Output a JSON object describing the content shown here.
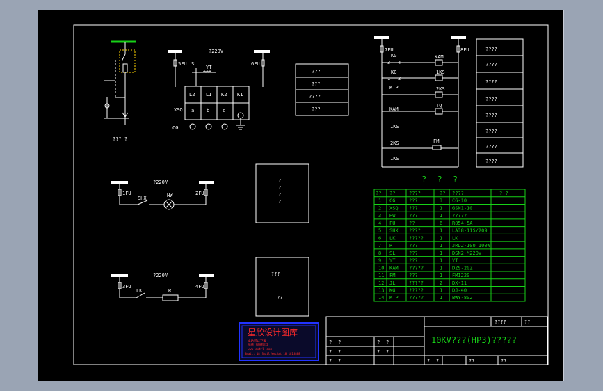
{
  "diagram": {
    "control_circuit": {
      "voltage": "?220V",
      "fuse_left": "5FU",
      "fuse_right": "6FU",
      "sl": "SL",
      "yt": "YT",
      "terminals": [
        "L2",
        "L1",
        "K2",
        "K1"
      ],
      "xsq": "XSQ",
      "contacts": [
        "a",
        "b",
        "c"
      ],
      "cg": "CG"
    },
    "primary_label": "??? ?",
    "legend_small": [
      "???",
      "???",
      "????",
      "???"
    ],
    "right_circuit": {
      "fu_left": "7FU",
      "fu_right": "8FU",
      "row_labels": [
        "KG",
        "3",
        "4",
        "KG",
        "1",
        "2",
        "KTP",
        "KAM",
        "1KS",
        "2KS",
        "1KS"
      ],
      "coil_labels": [
        "KAM",
        "1KS",
        "2KS",
        "TQ",
        "FM"
      ]
    },
    "right_legend": [
      "????",
      "????",
      "????",
      "????",
      "????",
      "????",
      "????",
      "????"
    ],
    "signal_circuit": {
      "voltage": "?220V",
      "fu_left": "1FU",
      "fu_right": "2FU",
      "switch": "SHX",
      "lamp": "HW"
    },
    "heater_circuit": {
      "voltage": "?220V",
      "fu_left": "3FU",
      "fu_right": "4FU",
      "switch": "LK",
      "resistor": "R"
    },
    "box1_lines": [
      "?",
      "?",
      "?",
      "?"
    ],
    "box2_lines": [
      "???",
      "??"
    ],
    "table_title": "? ? ?",
    "table_headers": [
      "??",
      "??",
      "????",
      "??",
      "????",
      "? ?"
    ],
    "table_rows": [
      [
        "1",
        "CG",
        "???",
        "3",
        "CG-10"
      ],
      [
        "2",
        "XSQ",
        "???",
        "1",
        "GSN1-10"
      ],
      [
        "3",
        "HW",
        "???",
        "1",
        "?????"
      ],
      [
        "4",
        "FU",
        "??",
        "6",
        "R054-5A"
      ],
      [
        "5",
        "SHX",
        "????",
        "1",
        "LA38-11S/209"
      ],
      [
        "6",
        "LK",
        "?????",
        "1",
        "LK"
      ],
      [
        "7",
        "R",
        "???",
        "1",
        "JRD2-100 100W"
      ],
      [
        "8",
        "SL",
        "???",
        "1",
        "DSN2-M220V"
      ],
      [
        "9",
        "YT",
        "???",
        "1",
        "YT"
      ],
      [
        "10",
        "KAM",
        "?????",
        "1",
        "DZS-20Z"
      ],
      [
        "11",
        "FM",
        "???",
        "1",
        "FM1220"
      ],
      [
        "12",
        "JL",
        "?????",
        "2",
        "DX-11"
      ],
      [
        "13",
        "KG",
        "?????",
        "1",
        "DJ-40"
      ],
      [
        "14",
        "KTP",
        "?????",
        "1",
        "BWY-802"
      ]
    ],
    "title_block": {
      "title": "10KV???(HP3)?????",
      "cells_top": [
        "????",
        "??"
      ],
      "cells_bottom": [
        "??",
        "??"
      ],
      "marks": [
        "?",
        "?",
        "?",
        "?",
        "?",
        "?",
        "?",
        "?",
        "?",
        "?",
        "?",
        "?"
      ]
    },
    "logo": {
      "name": "星欣设计图库",
      "lines": [
        "本站可以下载",
        "图纸 图纸资料",
        "www  cxtf8 com",
        "Email: 18 Email Wechat  18 1818888"
      ]
    }
  }
}
